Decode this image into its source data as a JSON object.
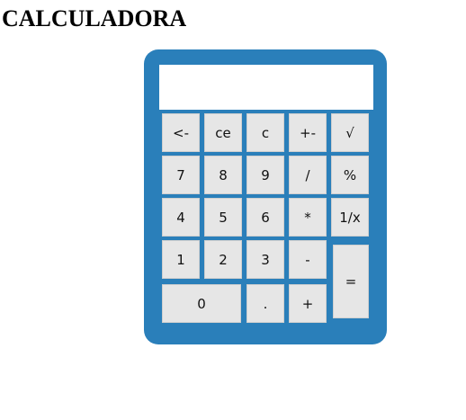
{
  "page": {
    "title": "CALCULADORA"
  },
  "display": {
    "value": ""
  },
  "keys": {
    "backspace": "<-",
    "ce": "ce",
    "c": "c",
    "plus_minus": "+-",
    "sqrt": "√",
    "seven": "7",
    "eight": "8",
    "nine": "9",
    "divide": "/",
    "percent": "%",
    "four": "4",
    "five": "5",
    "six": "6",
    "multiply": "*",
    "reciprocal": "1/x",
    "one": "1",
    "two": "2",
    "three": "3",
    "minus": "-",
    "equals": "=",
    "zero": "0",
    "dot": ".",
    "plus": "+"
  },
  "colors": {
    "body": "#2a7fba",
    "key": "#e6e6e6",
    "display": "#ffffff"
  }
}
